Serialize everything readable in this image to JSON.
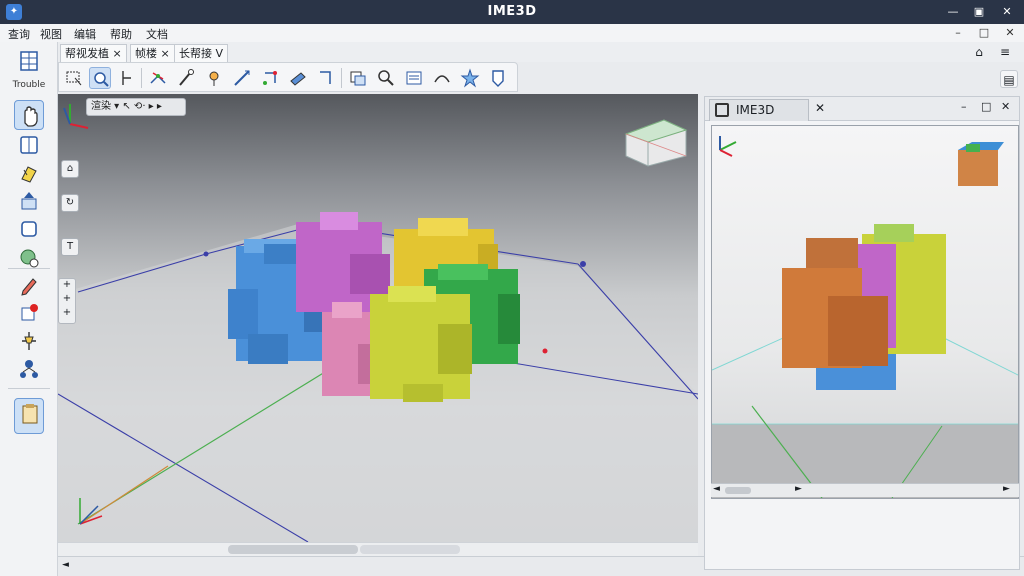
{
  "window": {
    "title": "IME3D",
    "app_icon": "app-logo-icon",
    "controls": [
      "minimize-icon",
      "maximize-icon",
      "close-icon"
    ]
  },
  "menu": {
    "items": [
      "查询",
      "视图",
      "编辑",
      "帮助",
      "文档"
    ]
  },
  "doc_controls": [
    "minimize-icon",
    "restore-icon",
    "close-icon"
  ],
  "doc_tabs": [
    {
      "label": "帮视发植 ×"
    },
    {
      "label": "帧楼 ×"
    },
    {
      "label": "长帮接 V"
    }
  ],
  "toolbar": {
    "icons": [
      "select-region-icon",
      "zoom-icon",
      "axis-tool-icon",
      "transform-icon",
      "probe-icon",
      "rotate-icon",
      "measure-icon",
      "move-icon",
      "fly-icon",
      "section-icon",
      "copy-view-icon",
      "search-icon",
      "layers-icon",
      "lens-icon",
      "star-icon",
      "tag-icon"
    ]
  },
  "right_header_icons": [
    "home-icon",
    "list-icon"
  ],
  "left_toolbar": {
    "items": [
      {
        "icon": "model-tree-icon",
        "label": "Trouble"
      },
      {
        "icon": "pan-hand-icon"
      },
      {
        "icon": "layout-icon"
      },
      {
        "icon": "highlight-icon"
      },
      {
        "icon": "upload-box-icon"
      },
      {
        "icon": "frame-icon"
      },
      {
        "icon": "globe-icon"
      },
      {
        "icon": "pencil-icon"
      },
      {
        "icon": "notify-icon"
      },
      {
        "icon": "pin-icon"
      },
      {
        "icon": "network-icon"
      },
      {
        "icon": "paste-icon"
      }
    ]
  },
  "viewport": {
    "chip_label": "渲染 ▾  ↖ ⟲· ▸ ▸",
    "side_buttons": [
      "⌂",
      "↻",
      "T"
    ],
    "arrow_buttons": [
      "+",
      "+",
      "+"
    ],
    "status": "◄"
  },
  "side_view": {
    "tab_label": "IME3D",
    "controls": [
      "minimize-icon",
      "restore-icon",
      "close-icon"
    ]
  },
  "colors": {
    "titlebar": "#2a3447",
    "accent": "#3e7fd6",
    "block_blue": "#4a90d9",
    "block_magenta": "#c066c8",
    "block_yellow": "#e3c531",
    "block_green": "#33a84a",
    "block_pink": "#dc86b4",
    "block_lime": "#c9d23a",
    "block_orange": "#d07a3a"
  }
}
